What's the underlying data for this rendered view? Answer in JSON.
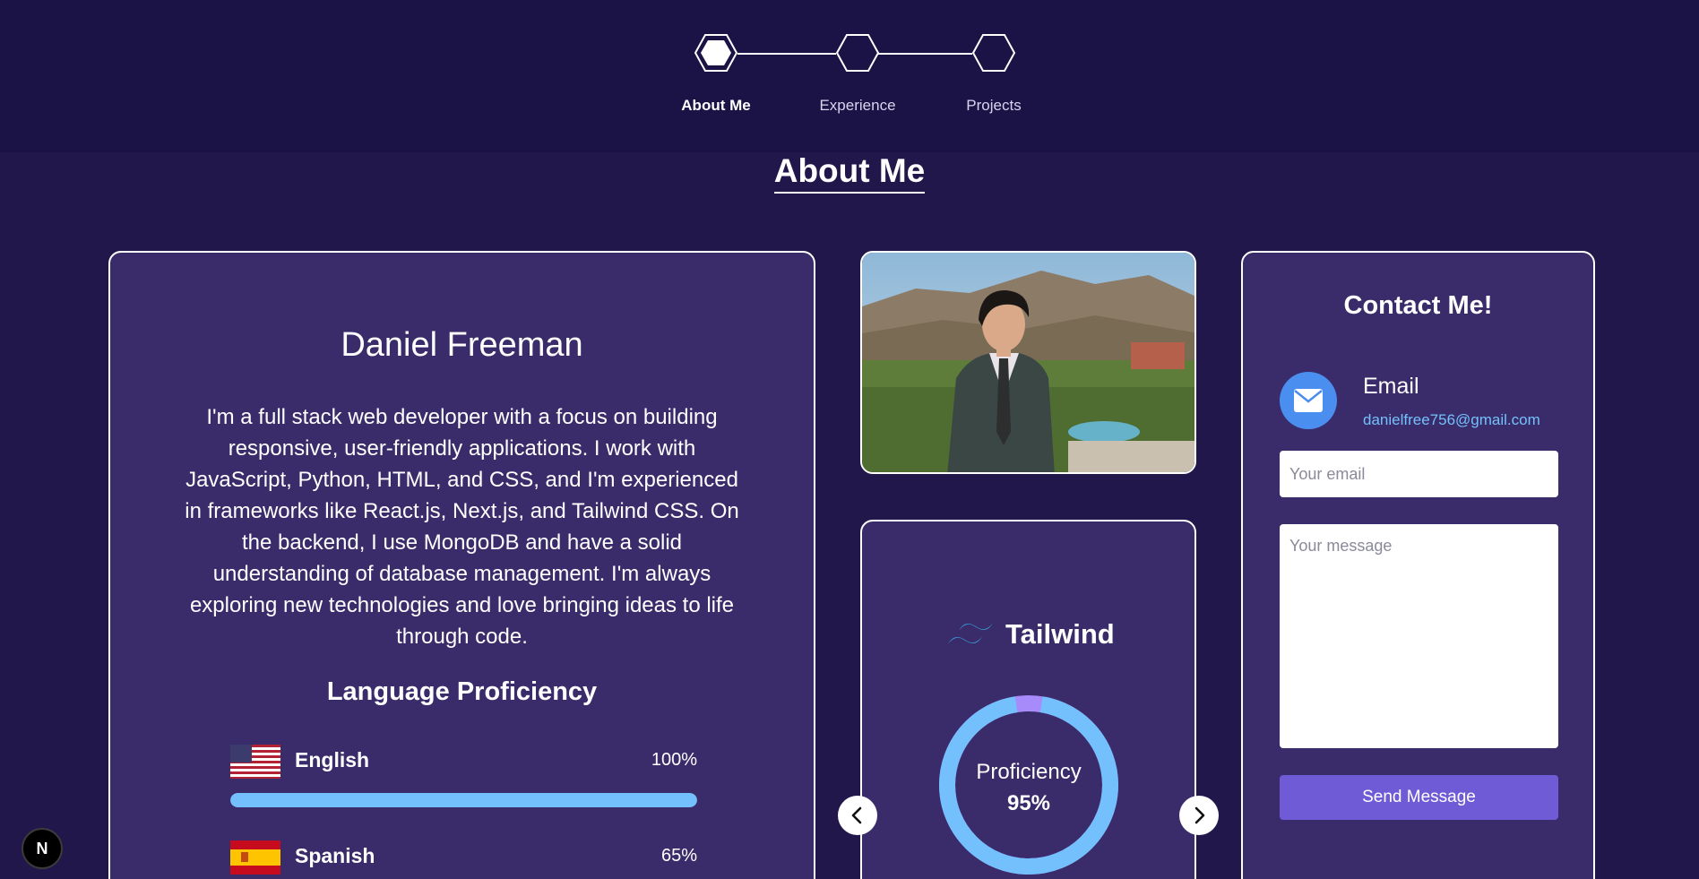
{
  "stepper": {
    "steps": [
      {
        "label": "About Me",
        "active": true
      },
      {
        "label": "Experience",
        "active": false
      },
      {
        "label": "Projects",
        "active": false
      }
    ]
  },
  "page": {
    "title": "About Me"
  },
  "about": {
    "name": "Daniel Freeman",
    "bio": "I'm a full stack web developer with a focus on building responsive, user-friendly applications. I work with JavaScript, Python, HTML, and CSS, and I'm experienced in frameworks like React.js, Next.js, and Tailwind CSS. On the backend, I use MongoDB and have a solid understanding of database management. I'm always exploring new technologies and love bringing ideas to life through code.",
    "language_title": "Language Proficiency",
    "languages": [
      {
        "name": "English",
        "percent_label": "100%",
        "percent": 100,
        "flag": "us-flag-icon"
      },
      {
        "name": "Spanish",
        "percent_label": "65%",
        "percent": 65,
        "flag": "spain-flag-icon"
      }
    ]
  },
  "skill": {
    "name": "Tailwind",
    "icon": "tailwind-icon",
    "label": "Proficiency",
    "percent_label": "95%",
    "percent": 95,
    "ring_color": "#74c0fc"
  },
  "contact": {
    "title": "Contact Me!",
    "email_label": "Email",
    "email_value": "danielfree756@gmail.com",
    "email_placeholder": "Your email",
    "message_placeholder": "Your message",
    "send_label": "Send Message"
  },
  "badge": {
    "letter": "N"
  },
  "colors": {
    "background": "#22174a",
    "card": "#3a2c6a",
    "accent_blue": "#74c0fc",
    "button": "#6f5bd6"
  }
}
